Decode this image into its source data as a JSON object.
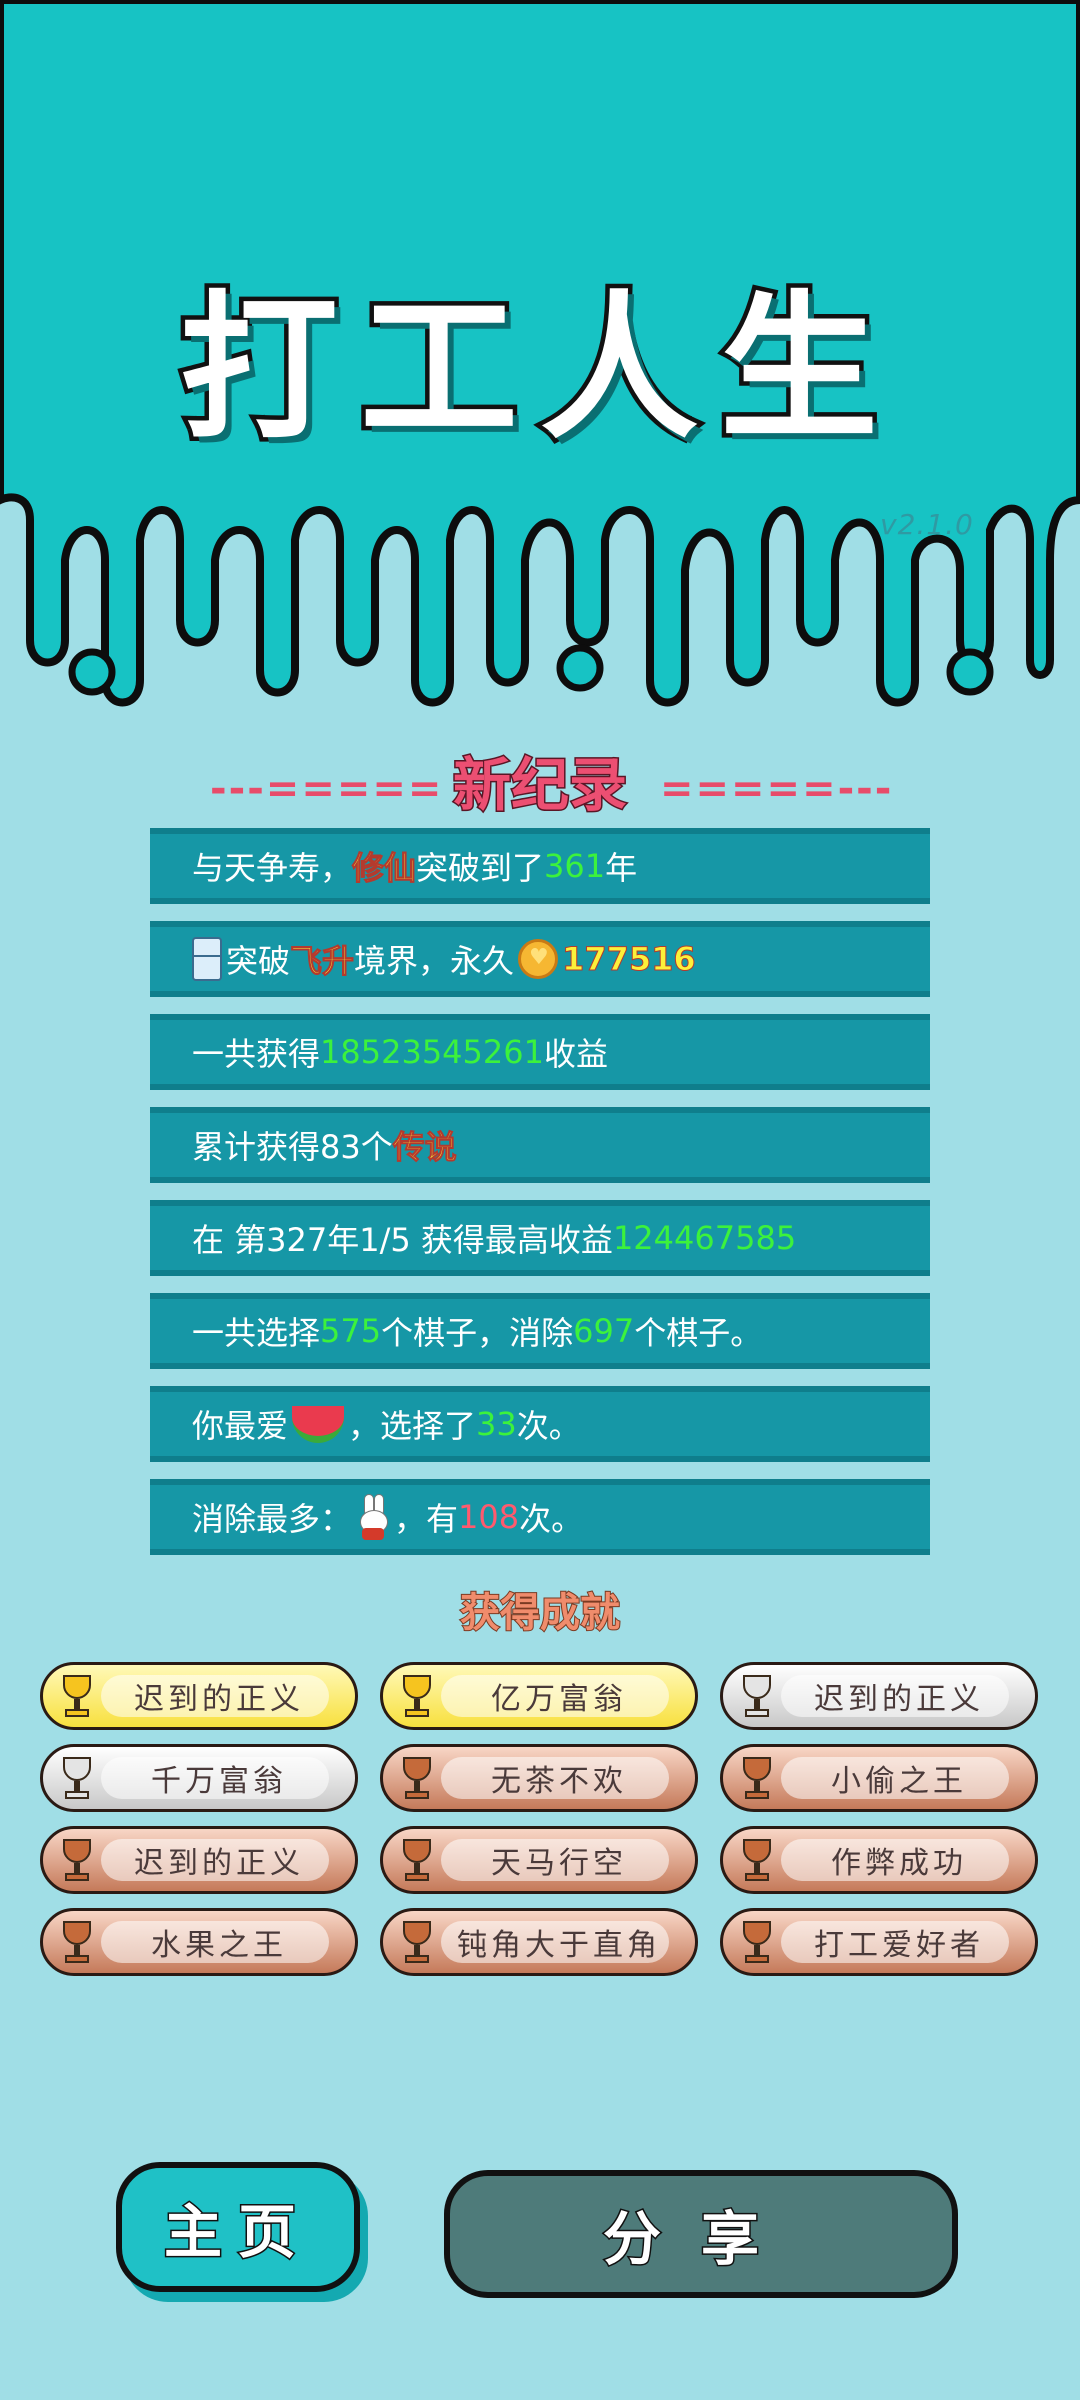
{
  "app": {
    "title": "打工人生",
    "version": "v2.1.0"
  },
  "record": {
    "title": "新纪录",
    "dash_left": "---=====",
    "dash_right": "=====---"
  },
  "stats": {
    "r1": {
      "a": "与天争寿，",
      "b": "修仙",
      "c": "突破到了",
      "d": "361",
      "e": "年"
    },
    "r2": {
      "a": "突破",
      "b": "飞升",
      "c": "境界，永久",
      "d": "177516"
    },
    "r3": {
      "a": "一共获得",
      "b": "18523545261",
      "c": "收益"
    },
    "r4": {
      "a": "累计获得83个",
      "b": "传说"
    },
    "r5": {
      "a": "在 第327年1/5 获得最高收益",
      "b": "124467585"
    },
    "r6": {
      "a": "一共选择",
      "b": "575",
      "c": "个棋子，消除",
      "d": "697",
      "e": "个棋子。"
    },
    "r7": {
      "a": "你最爱",
      "b": "，选择了",
      "c": "33",
      "d": "次。"
    },
    "r8": {
      "a": "消除最多：",
      "b": "，有",
      "c": "108",
      "d": "次。"
    }
  },
  "achievements": {
    "title": "获得成就",
    "items": [
      {
        "label": "迟到的正义",
        "tier": "gold"
      },
      {
        "label": "亿万富翁",
        "tier": "gold"
      },
      {
        "label": "迟到的正义",
        "tier": "silver"
      },
      {
        "label": "千万富翁",
        "tier": "silver"
      },
      {
        "label": "无茶不欢",
        "tier": "bronze"
      },
      {
        "label": "小偷之王",
        "tier": "bronze"
      },
      {
        "label": "迟到的正义",
        "tier": "bronze"
      },
      {
        "label": "天马行空",
        "tier": "bronze"
      },
      {
        "label": "作弊成功",
        "tier": "bronze"
      },
      {
        "label": "水果之王",
        "tier": "bronze"
      },
      {
        "label": "钝角大于直角",
        "tier": "bronze"
      },
      {
        "label": "打工爱好者",
        "tier": "bronze"
      }
    ]
  },
  "buttons": {
    "home": "主页",
    "share": "分享"
  },
  "colors": {
    "top_band": "#17c3c4",
    "page_bg": "#a0dee6",
    "row_bg": "#1697a6",
    "share_btn": "#4e7b7a"
  }
}
